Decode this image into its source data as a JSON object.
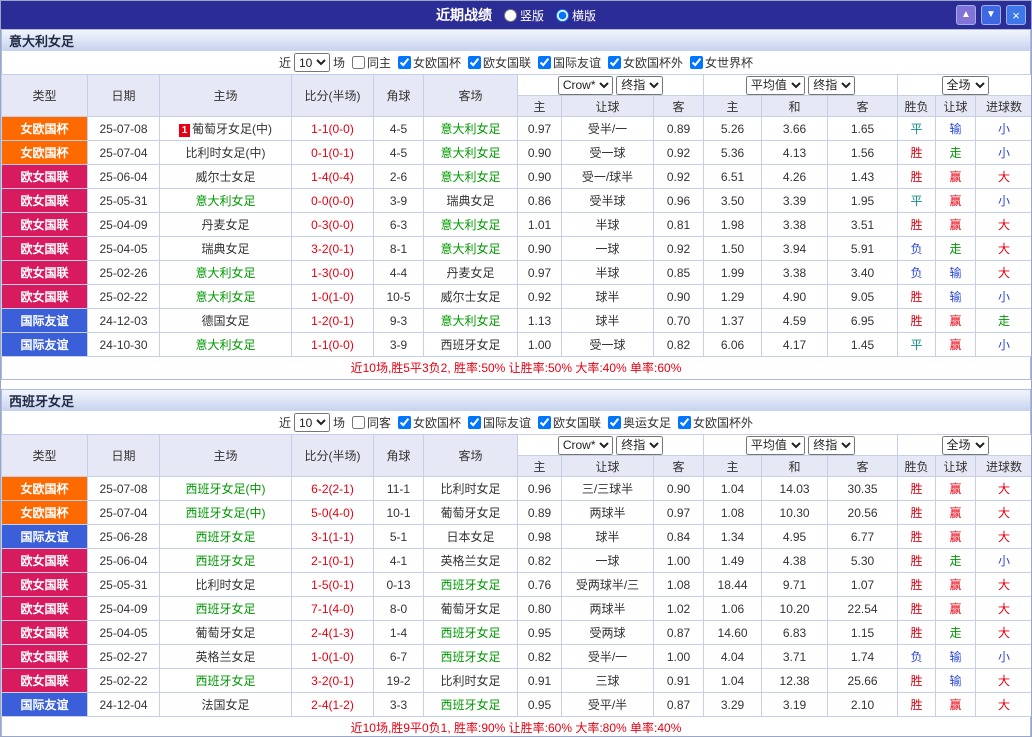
{
  "titlebar": {
    "title": "近期战绩",
    "layout_options": [
      {
        "label": "竖版",
        "checked": false
      },
      {
        "label": "横版",
        "checked": true
      }
    ],
    "up_button": "▲",
    "down_button": "▼",
    "close_button": "×"
  },
  "labels": {
    "near": "近",
    "matches": "场"
  },
  "table_header": {
    "cols": [
      "类型",
      "日期",
      "主场",
      "比分(半场)",
      "角球",
      "客场"
    ],
    "company_select": "Crow*",
    "index_select": "终指",
    "avg_select": "平均值",
    "index_select2": "终指",
    "scope_select": "全场",
    "sub": [
      "主",
      "让球",
      "客",
      "主",
      "和",
      "客",
      "胜负",
      "让球",
      "进球数"
    ]
  },
  "type_colors": {
    "女欧国杯": "#ff6a00",
    "欧女国联": "#d81b5e",
    "国际友谊": "#3a5fd9"
  },
  "result_colors": {
    "胜": "red",
    "平": "teal",
    "负": "blue",
    "赢": "red",
    "输": "blue",
    "走": "green",
    "大": "red",
    "小": "blue"
  },
  "sections": [
    {
      "team": "意大利女足",
      "filter": {
        "count": "10",
        "same_label": "同主",
        "same_checked": false,
        "competitions": [
          {
            "label": "女欧国杯",
            "checked": true
          },
          {
            "label": "欧女国联",
            "checked": true
          },
          {
            "label": "国际友谊",
            "checked": true
          },
          {
            "label": "女欧国杯外",
            "checked": true
          },
          {
            "label": "女世界杯",
            "checked": true
          }
        ]
      },
      "rows": [
        {
          "type": "女欧国杯",
          "date": "25-07-08",
          "home": "葡萄牙女足(中)",
          "home_green": false,
          "marker": "1",
          "score": "1-1(0-0)",
          "corner": "4-5",
          "away": "意大利女足",
          "away_green": true,
          "odds": [
            "0.97",
            "受半/一",
            "0.89"
          ],
          "avg": [
            "5.26",
            "3.66",
            "1.65"
          ],
          "results": [
            "平",
            "输",
            "小"
          ]
        },
        {
          "type": "女欧国杯",
          "date": "25-07-04",
          "home": "比利时女足(中)",
          "home_green": false,
          "score": "0-1(0-1)",
          "corner": "4-5",
          "away": "意大利女足",
          "away_green": true,
          "odds": [
            "0.90",
            "受一球",
            "0.92"
          ],
          "avg": [
            "5.36",
            "4.13",
            "1.56"
          ],
          "results": [
            "胜",
            "走",
            "小"
          ]
        },
        {
          "type": "欧女国联",
          "date": "25-06-04",
          "home": "威尔士女足",
          "home_green": false,
          "score": "1-4(0-4)",
          "corner": "2-6",
          "away": "意大利女足",
          "away_green": true,
          "odds": [
            "0.90",
            "受一/球半",
            "0.92"
          ],
          "avg": [
            "6.51",
            "4.26",
            "1.43"
          ],
          "results": [
            "胜",
            "赢",
            "大"
          ]
        },
        {
          "type": "欧女国联",
          "date": "25-05-31",
          "home": "意大利女足",
          "home_green": true,
          "score": "0-0(0-0)",
          "corner": "3-9",
          "away": "瑞典女足",
          "away_green": false,
          "odds": [
            "0.86",
            "受半球",
            "0.96"
          ],
          "avg": [
            "3.50",
            "3.39",
            "1.95"
          ],
          "results": [
            "平",
            "赢",
            "小"
          ]
        },
        {
          "type": "欧女国联",
          "date": "25-04-09",
          "home": "丹麦女足",
          "home_green": false,
          "score": "0-3(0-0)",
          "corner": "6-3",
          "away": "意大利女足",
          "away_green": true,
          "odds": [
            "1.01",
            "半球",
            "0.81"
          ],
          "avg": [
            "1.98",
            "3.38",
            "3.51"
          ],
          "results": [
            "胜",
            "赢",
            "大"
          ]
        },
        {
          "type": "欧女国联",
          "date": "25-04-05",
          "home": "瑞典女足",
          "home_green": false,
          "score": "3-2(0-1)",
          "corner": "8-1",
          "away": "意大利女足",
          "away_green": true,
          "odds": [
            "0.90",
            "一球",
            "0.92"
          ],
          "avg": [
            "1.50",
            "3.94",
            "5.91"
          ],
          "results": [
            "负",
            "走",
            "大"
          ]
        },
        {
          "type": "欧女国联",
          "date": "25-02-26",
          "home": "意大利女足",
          "home_green": true,
          "score": "1-3(0-0)",
          "corner": "4-4",
          "away": "丹麦女足",
          "away_green": false,
          "odds": [
            "0.97",
            "半球",
            "0.85"
          ],
          "avg": [
            "1.99",
            "3.38",
            "3.40"
          ],
          "results": [
            "负",
            "输",
            "大"
          ]
        },
        {
          "type": "欧女国联",
          "date": "25-02-22",
          "home": "意大利女足",
          "home_green": true,
          "score": "1-0(1-0)",
          "corner": "10-5",
          "away": "威尔士女足",
          "away_green": false,
          "odds": [
            "0.92",
            "球半",
            "0.90"
          ],
          "avg": [
            "1.29",
            "4.90",
            "9.05"
          ],
          "results": [
            "胜",
            "输",
            "小"
          ]
        },
        {
          "type": "国际友谊",
          "date": "24-12-03",
          "home": "德国女足",
          "home_green": false,
          "score": "1-2(0-1)",
          "corner": "9-3",
          "away": "意大利女足",
          "away_green": true,
          "odds": [
            "1.13",
            "球半",
            "0.70"
          ],
          "avg": [
            "1.37",
            "4.59",
            "6.95"
          ],
          "results": [
            "胜",
            "赢",
            "走"
          ]
        },
        {
          "type": "国际友谊",
          "date": "24-10-30",
          "home": "意大利女足",
          "home_green": true,
          "score": "1-1(0-0)",
          "corner": "3-9",
          "away": "西班牙女足",
          "away_green": false,
          "odds": [
            "1.00",
            "受一球",
            "0.82"
          ],
          "avg": [
            "6.06",
            "4.17",
            "1.45"
          ],
          "results": [
            "平",
            "赢",
            "小"
          ]
        }
      ],
      "summary": "近10场,胜5平3负2, 胜率:50% 让胜率:50% 大率:40% 单率:60%"
    },
    {
      "team": "西班牙女足",
      "filter": {
        "count": "10",
        "same_label": "同客",
        "same_checked": false,
        "competitions": [
          {
            "label": "女欧国杯",
            "checked": true
          },
          {
            "label": "国际友谊",
            "checked": true
          },
          {
            "label": "欧女国联",
            "checked": true
          },
          {
            "label": "奥运女足",
            "checked": true
          },
          {
            "label": "女欧国杯外",
            "checked": true
          }
        ]
      },
      "rows": [
        {
          "type": "女欧国杯",
          "date": "25-07-08",
          "home": "西班牙女足(中)",
          "home_green": true,
          "score": "6-2(2-1)",
          "corner": "11-1",
          "away": "比利时女足",
          "away_green": false,
          "odds": [
            "0.96",
            "三/三球半",
            "0.90"
          ],
          "avg": [
            "1.04",
            "14.03",
            "30.35"
          ],
          "results": [
            "胜",
            "赢",
            "大"
          ]
        },
        {
          "type": "女欧国杯",
          "date": "25-07-04",
          "home": "西班牙女足(中)",
          "home_green": true,
          "score": "5-0(4-0)",
          "corner": "10-1",
          "away": "葡萄牙女足",
          "away_green": false,
          "odds": [
            "0.89",
            "两球半",
            "0.97"
          ],
          "avg": [
            "1.08",
            "10.30",
            "20.56"
          ],
          "results": [
            "胜",
            "赢",
            "大"
          ]
        },
        {
          "type": "国际友谊",
          "date": "25-06-28",
          "home": "西班牙女足",
          "home_green": true,
          "score": "3-1(1-1)",
          "corner": "5-1",
          "away": "日本女足",
          "away_green": false,
          "odds": [
            "0.98",
            "球半",
            "0.84"
          ],
          "avg": [
            "1.34",
            "4.95",
            "6.77"
          ],
          "results": [
            "胜",
            "赢",
            "大"
          ]
        },
        {
          "type": "欧女国联",
          "date": "25-06-04",
          "home": "西班牙女足",
          "home_green": true,
          "score": "2-1(0-1)",
          "corner": "4-1",
          "away": "英格兰女足",
          "away_green": false,
          "odds": [
            "0.82",
            "一球",
            "1.00"
          ],
          "avg": [
            "1.49",
            "4.38",
            "5.30"
          ],
          "results": [
            "胜",
            "走",
            "小"
          ]
        },
        {
          "type": "欧女国联",
          "date": "25-05-31",
          "home": "比利时女足",
          "home_green": false,
          "score": "1-5(0-1)",
          "corner": "0-13",
          "away": "西班牙女足",
          "away_green": true,
          "odds": [
            "0.76",
            "受两球半/三",
            "1.08"
          ],
          "avg": [
            "18.44",
            "9.71",
            "1.07"
          ],
          "results": [
            "胜",
            "赢",
            "大"
          ]
        },
        {
          "type": "欧女国联",
          "date": "25-04-09",
          "home": "西班牙女足",
          "home_green": true,
          "score": "7-1(4-0)",
          "corner": "8-0",
          "away": "葡萄牙女足",
          "away_green": false,
          "odds": [
            "0.80",
            "两球半",
            "1.02"
          ],
          "avg": [
            "1.06",
            "10.20",
            "22.54"
          ],
          "results": [
            "胜",
            "赢",
            "大"
          ]
        },
        {
          "type": "欧女国联",
          "date": "25-04-05",
          "home": "葡萄牙女足",
          "home_green": false,
          "score": "2-4(1-3)",
          "corner": "1-4",
          "away": "西班牙女足",
          "away_green": true,
          "odds": [
            "0.95",
            "受两球",
            "0.87"
          ],
          "avg": [
            "14.60",
            "6.83",
            "1.15"
          ],
          "results": [
            "胜",
            "走",
            "大"
          ]
        },
        {
          "type": "欧女国联",
          "date": "25-02-27",
          "home": "英格兰女足",
          "home_green": false,
          "score": "1-0(1-0)",
          "corner": "6-7",
          "away": "西班牙女足",
          "away_green": true,
          "odds": [
            "0.82",
            "受半/一",
            "1.00"
          ],
          "avg": [
            "4.04",
            "3.71",
            "1.74"
          ],
          "results": [
            "负",
            "输",
            "小"
          ]
        },
        {
          "type": "欧女国联",
          "date": "25-02-22",
          "home": "西班牙女足",
          "home_green": true,
          "score": "3-2(0-1)",
          "corner": "19-2",
          "away": "比利时女足",
          "away_green": false,
          "odds": [
            "0.91",
            "三球",
            "0.91"
          ],
          "avg": [
            "1.04",
            "12.38",
            "25.66"
          ],
          "results": [
            "胜",
            "输",
            "大"
          ]
        },
        {
          "type": "国际友谊",
          "date": "24-12-04",
          "home": "法国女足",
          "home_green": false,
          "score": "2-4(1-2)",
          "corner": "3-3",
          "away": "西班牙女足",
          "away_green": true,
          "odds": [
            "0.95",
            "受平/半",
            "0.87"
          ],
          "avg": [
            "3.29",
            "3.19",
            "2.10"
          ],
          "results": [
            "胜",
            "赢",
            "大"
          ]
        }
      ],
      "summary": "近10场,胜9平0负1, 胜率:90% 让胜率:60% 大率:80% 单率:40%"
    }
  ]
}
